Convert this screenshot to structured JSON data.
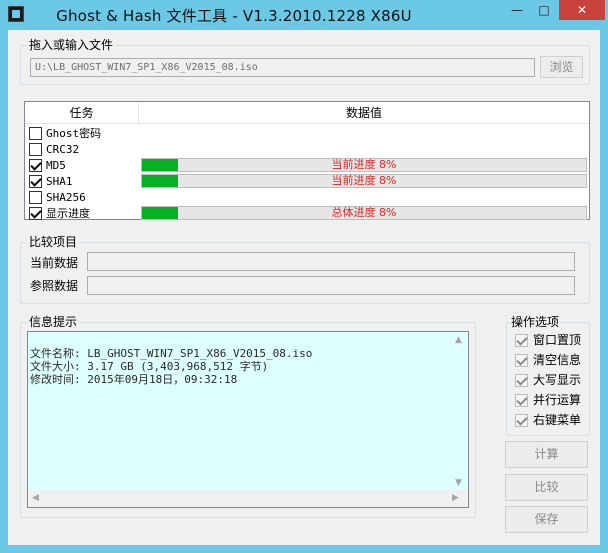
{
  "window": {
    "title": "Ghost & Hash 文件工具 - V1.3.2010.1228 X86U",
    "min_glyph": "—",
    "max_glyph": "□",
    "close_glyph": "✕"
  },
  "drop_group": {
    "label": "拖入或输入文件",
    "path_value": "U:\\LB_GHOST_WIN7_SP1_X86_V2015_08.iso",
    "browse_label": "浏览"
  },
  "task_list": {
    "headers": {
      "task": "任务",
      "value": "数据值"
    },
    "rows": [
      {
        "label": "Ghost密码",
        "checked": false,
        "progress": null,
        "text": ""
      },
      {
        "label": "CRC32",
        "checked": false,
        "progress": null,
        "text": ""
      },
      {
        "label": "MD5",
        "checked": true,
        "progress": 0.08,
        "text": "当前进度 8%"
      },
      {
        "label": "SHA1",
        "checked": true,
        "progress": 0.08,
        "text": "当前进度 8%"
      },
      {
        "label": "SHA256",
        "checked": false,
        "progress": null,
        "text": ""
      },
      {
        "label": "显示进度",
        "checked": true,
        "progress": 0.08,
        "text": "总体进度 8%"
      }
    ]
  },
  "compare_group": {
    "label": "比较项目",
    "current_label": "当前数据",
    "current_value": "",
    "reference_label": "参照数据",
    "reference_value": ""
  },
  "info_group": {
    "label": "信息提示",
    "lines": [
      "文件名称: LB_GHOST_WIN7_SP1_X86_V2015_08.iso",
      "文件大小: 3.17 GB (3,403,968,512 字节)",
      "修改时间: 2015年09月18日，09:32:18"
    ]
  },
  "options_group": {
    "label": "操作选项",
    "items": [
      {
        "label": "窗口置顶",
        "checked": true
      },
      {
        "label": "清空信息",
        "checked": true
      },
      {
        "label": "大写显示",
        "checked": true
      },
      {
        "label": "并行运算",
        "checked": true
      },
      {
        "label": "右键菜单",
        "checked": true
      }
    ]
  },
  "actions": {
    "compute_label": "计算",
    "compare_label": "比较",
    "save_label": "保存"
  },
  "colors": {
    "titlebar": "#6cc9e6",
    "progress_fill": "#06b025",
    "progress_text": "#e52222",
    "info_background": "#ddfffd",
    "close_button": "#c8413a"
  }
}
